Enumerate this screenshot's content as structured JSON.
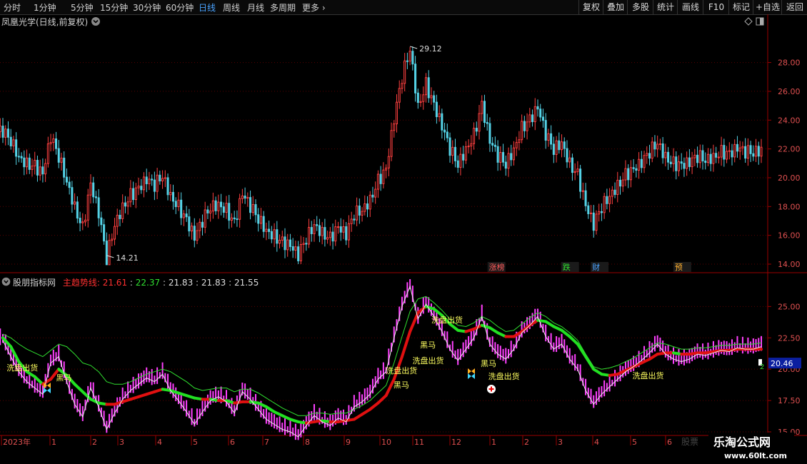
{
  "toolbar": {
    "periods": [
      "分时",
      "1分钟",
      "5分钟",
      "15分钟",
      "30分钟",
      "60分钟",
      "日线",
      "周线",
      "月线",
      "多周期"
    ],
    "active_period": "日线",
    "more_label": "更多",
    "buttons": [
      "复权",
      "叠加",
      "多股",
      "统计",
      "画线",
      "F10",
      "标记",
      "+自选",
      "返回"
    ]
  },
  "price_panel": {
    "title": "凤凰光学(日线,前复权)",
    "high_label": "29.12",
    "low_label": "14.21",
    "y_ticks": [
      "28.00",
      "26.00",
      "24.00",
      "22.00",
      "20.00",
      "18.00",
      "16.00",
      "14.00"
    ],
    "markers": [
      {
        "text": "涨榜",
        "color": "#ff5a5a"
      },
      {
        "text": "跌",
        "color": "#30e030"
      },
      {
        "text": "财",
        "color": "#4aa3ff"
      },
      {
        "text": "预",
        "color": "#ffb030"
      }
    ]
  },
  "indicator_panel": {
    "title": "股朋指标网",
    "line_name": "主趋势线:",
    "v1": "21.61",
    "v2": "22.37",
    "v3": "21.83",
    "v4": "21.83",
    "v5": "21.55",
    "sep": ":",
    "y_ticks": [
      "25.00",
      "22.50",
      "20.00",
      "17.50",
      "15.00"
    ],
    "current_value": "20.46",
    "signals": [
      "洗盘出货",
      "黑马",
      "洗盘出货",
      "黑马",
      "洗盘出货",
      "洗盘出货",
      "黑马",
      "洗盘出货",
      "黑马",
      "洗盘出货"
    ],
    "side_label": "2"
  },
  "date_axis": {
    "labels": [
      "2023年",
      "1",
      "2",
      "3",
      "4",
      "5",
      "6",
      "7",
      "8",
      "9",
      "10",
      "11",
      "12",
      "1",
      "2",
      "3",
      "4",
      "5",
      "6"
    ]
  },
  "watermark": {
    "brand": "乐淘公式网",
    "url": "www.60lt.com",
    "faint": "股票"
  },
  "colors": {
    "up": "#ff4040",
    "down": "#54d2e6",
    "bull": "#e01010",
    "bear": "#22e022",
    "pink": "#ff40ff",
    "axis": "#9b0000"
  },
  "chart_data": {
    "type": "candlestick",
    "price": {
      "ylim": [
        14,
        29.12
      ],
      "series": [
        {
          "name": "close",
          "values": [
            23.2,
            22.6,
            21.5,
            21.0,
            20.8,
            20.2,
            22.8,
            21.5,
            19.8,
            18.0,
            16.5,
            19.5,
            17.5,
            14.4,
            16.8,
            18.0,
            18.8,
            19.2,
            19.8,
            19.5,
            20.2,
            18.8,
            18.0,
            17.0,
            15.8,
            17.0,
            18.0,
            18.2,
            17.8,
            16.8,
            18.8,
            18.0,
            17.2,
            16.4,
            16.0,
            15.5,
            15.2,
            14.6,
            15.8,
            16.8,
            16.2,
            15.8,
            16.5,
            16.0,
            17.5,
            17.8,
            18.5,
            19.8,
            20.5,
            24.0,
            27.0,
            29.0,
            25.0,
            26.5,
            25.0,
            23.5,
            22.0,
            21.0,
            22.0,
            23.0,
            25.0,
            22.5,
            21.5,
            21.0,
            22.0,
            23.5,
            24.0,
            24.8,
            23.0,
            22.0,
            22.5,
            21.0,
            20.2,
            18.0,
            16.7,
            18.0,
            18.8,
            19.5,
            20.2,
            20.5,
            21.0,
            21.8,
            22.5,
            21.5,
            21.0,
            20.8,
            21.0,
            21.5,
            21.3,
            21.5,
            21.8,
            21.6,
            22.0,
            21.8,
            21.8,
            22.0
          ]
        }
      ]
    },
    "indicator": {
      "ylim": [
        15,
        26.5
      ],
      "series": [
        {
          "name": "trend_red",
          "values": [
            22.5,
            21.8,
            20.6,
            19.8,
            19.4,
            18.8,
            19.2,
            20.0,
            19.5,
            18.8,
            18.2,
            17.6,
            17.3,
            17.2,
            17.2,
            17.4,
            17.6,
            17.8,
            18.0,
            18.2,
            18.4,
            18.3,
            18.1,
            17.9,
            17.7,
            17.6,
            17.6,
            17.5,
            17.5,
            17.3,
            17.4,
            17.4,
            17.3,
            17.0,
            16.6,
            16.3,
            16.0,
            15.8,
            15.7,
            15.8,
            15.9,
            15.8,
            15.8,
            15.9,
            16.0,
            16.4,
            16.8,
            17.3,
            17.9,
            19.2,
            21.0,
            23.0,
            24.5,
            25.0,
            24.8,
            24.3,
            23.6,
            23.1,
            23.0,
            23.2,
            23.5,
            23.3,
            22.9,
            22.6,
            22.6,
            23.0,
            23.5,
            23.9,
            23.8,
            23.4,
            23.1,
            22.6,
            22.0,
            21.0,
            20.0,
            19.6,
            19.5,
            19.6,
            19.9,
            20.2,
            20.5,
            20.8,
            21.2,
            21.3,
            21.3,
            21.2,
            21.2,
            21.3,
            21.3,
            21.4,
            21.5,
            21.5,
            21.6,
            21.6,
            21.6,
            21.6
          ]
        },
        {
          "name": "white",
          "values": [
            22.3,
            21.0,
            19.8,
            19.0,
            18.5,
            18.0,
            20.5,
            21.0,
            19.0,
            17.2,
            16.2,
            18.5,
            17.0,
            15.2,
            16.5,
            17.6,
            18.3,
            18.8,
            19.3,
            19.0,
            19.6,
            18.3,
            17.5,
            16.6,
            15.6,
            16.6,
            17.5,
            17.8,
            17.4,
            16.5,
            18.2,
            17.6,
            16.8,
            16.0,
            15.6,
            15.2,
            15.0,
            14.6,
            15.5,
            16.3,
            15.8,
            15.5,
            16.1,
            15.8,
            17.0,
            17.4,
            18.0,
            19.2,
            19.8,
            22.5,
            25.0,
            26.6,
            24.0,
            25.2,
            24.2,
            23.0,
            21.6,
            20.7,
            21.6,
            22.5,
            24.2,
            22.0,
            21.2,
            20.8,
            21.6,
            22.9,
            23.5,
            24.2,
            22.6,
            21.6,
            22.0,
            20.8,
            20.0,
            18.3,
            17.2,
            18.0,
            18.6,
            19.2,
            19.8,
            20.2,
            20.7,
            21.3,
            22.0,
            21.2,
            20.8,
            20.6,
            20.8,
            21.2,
            21.1,
            21.3,
            21.5,
            21.4,
            21.7,
            21.6,
            21.6,
            21.8
          ]
        },
        {
          "name": "thin_green",
          "values": [
            22.8,
            22.5,
            22.0,
            21.6,
            21.3,
            21.0,
            21.5,
            22.0,
            21.8,
            21.2,
            20.5,
            20.3,
            19.8,
            19.0,
            18.8,
            18.8,
            19.0,
            19.3,
            19.6,
            19.8,
            20.0,
            19.8,
            19.4,
            19.0,
            18.5,
            18.3,
            18.4,
            18.5,
            18.5,
            18.2,
            18.4,
            18.4,
            18.1,
            17.7,
            17.3,
            16.9,
            16.6,
            16.3,
            16.3,
            16.5,
            16.5,
            16.4,
            16.5,
            16.5,
            16.8,
            17.1,
            17.5,
            18.1,
            18.7,
            20.5,
            22.6,
            24.6,
            25.6,
            25.8,
            25.3,
            24.7,
            24.0,
            23.5,
            23.4,
            23.7,
            24.2,
            23.9,
            23.4,
            23.0,
            23.1,
            23.6,
            24.1,
            24.5,
            24.2,
            23.7,
            23.4,
            22.9,
            22.3,
            21.2,
            20.2,
            20.0,
            20.1,
            20.3,
            20.6,
            20.9,
            21.3,
            21.7,
            22.1,
            22.0,
            21.8,
            21.6,
            21.6,
            21.7,
            21.7,
            21.8,
            21.9,
            21.9,
            22.0,
            22.0,
            22.0,
            22.1
          ]
        }
      ]
    }
  }
}
